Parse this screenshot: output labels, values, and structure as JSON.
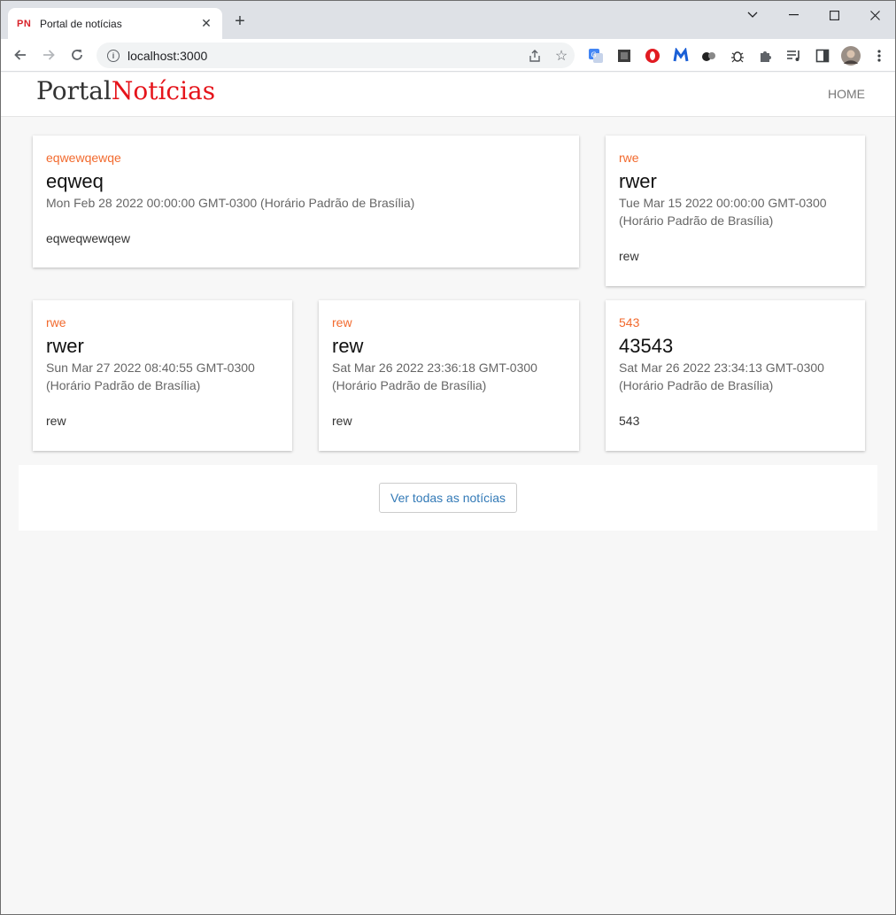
{
  "browser": {
    "tab": {
      "favicon": "PN",
      "title": "Portal de notícias"
    },
    "omnibox": {
      "url": "localhost:3000"
    }
  },
  "site": {
    "logo": {
      "part1": "Portal",
      "part2": "Notícias"
    },
    "nav": {
      "home": "HOME"
    }
  },
  "news": [
    {
      "category": "eqwewqewqe",
      "title": "eqweq",
      "date": "Mon Feb 28 2022 00:00:00 GMT-0300 (Horário Padrão de Brasília)",
      "summary": "eqweqwewqew"
    },
    {
      "category": "rwe",
      "title": "rwer",
      "date": "Tue Mar 15 2022 00:00:00 GMT-0300 (Horário Padrão de Brasília)",
      "summary": "rew"
    },
    {
      "category": "rwe",
      "title": "rwer",
      "date": "Sun Mar 27 2022 08:40:55 GMT-0300 (Horário Padrão de Brasília)",
      "summary": "rew"
    },
    {
      "category": "rew",
      "title": "rew",
      "date": "Sat Mar 26 2022 23:36:18 GMT-0300 (Horário Padrão de Brasília)",
      "summary": "rew"
    },
    {
      "category": "543",
      "title": "43543",
      "date": "Sat Mar 26 2022 23:34:13 GMT-0300 (Horário Padrão de Brasília)",
      "summary": "543"
    }
  ],
  "more_button": "Ver todas as notícias",
  "colors": {
    "category": "#f26a2e",
    "logo_accent": "#e5141b",
    "link": "#337ab7",
    "page_bg": "#f7f7f7"
  }
}
